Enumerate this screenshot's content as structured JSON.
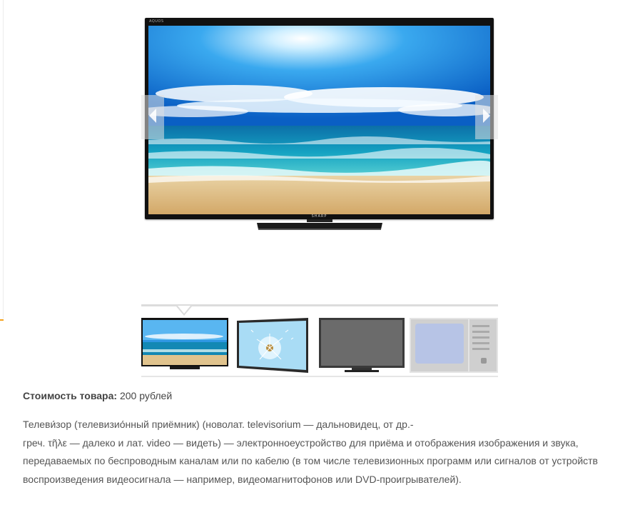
{
  "product": {
    "price_label": "Стоимость товара:",
    "price_value": "200 рублей",
    "description_lines": [
      "Телеви́зор (телевизио́нный приёмник) (новолат. televisorium — дальновидец, от др.-",
      "греч. τῆλε — далеко и лат. video — видеть) — электронноеустройство для приёма и отображения изображения и звука,",
      "передаваемых по беспроводным каналам или по кабелю (в том числе телевизионных программ или сигналов от устройств",
      "воспроизведения видеосигнала — например, видеомагнитофонов или DVD-проигрывателей)."
    ]
  },
  "gallery": {
    "main_image_icon": "tv-beach-image",
    "brand": "SHARP",
    "prev_icon": "arrow-left-icon",
    "next_icon": "arrow-right-icon",
    "thumbnails": [
      {
        "icon": "tv-beach-thumbnail"
      },
      {
        "icon": "tv-dandelion-thumbnail"
      },
      {
        "icon": "tv-gray-screen-thumbnail"
      },
      {
        "icon": "crt-tv-thumbnail"
      }
    ]
  },
  "colors": {
    "accent": "#f5a21c",
    "text": "#555555",
    "divider": "#dcdcdc"
  }
}
